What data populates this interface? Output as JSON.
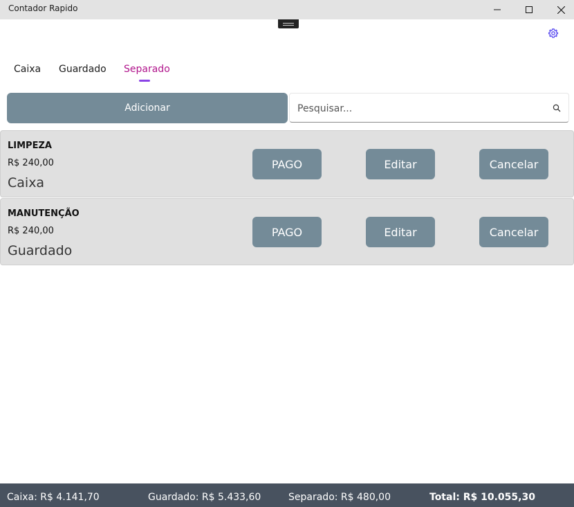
{
  "window": {
    "title": "Contador Rapido"
  },
  "tabs": [
    {
      "label": "Caixa"
    },
    {
      "label": "Guardado"
    },
    {
      "label": "Separado",
      "selected": true
    }
  ],
  "toolbar": {
    "add_label": "Adicionar",
    "search_placeholder": "Pesquisar..."
  },
  "items": [
    {
      "name": "LIMPEZA",
      "amount": "R$ 240,00",
      "location": "Caixa",
      "pay_label": "PAGO",
      "edit_label": "Editar",
      "cancel_label": "Cancelar"
    },
    {
      "name": "MANUTENÇÃO",
      "amount": "R$ 240,00",
      "location": "Guardado",
      "pay_label": "PAGO",
      "edit_label": "Editar",
      "cancel_label": "Cancelar"
    }
  ],
  "footer": {
    "caixa": "Caixa: R$ 4.141,70",
    "guardado": "Guardado: R$ 5.433,60",
    "separado": "Separado: R$ 480,00",
    "total": "Total: R$ 10.055,30"
  },
  "colors": {
    "accent_button": "#748b98",
    "active_tab": "#b0138b",
    "tab_indicator": "#8a43e6",
    "footer_bg": "#48525f",
    "card_bg": "#e0e0e0"
  },
  "icons": {
    "settings": "gear-icon",
    "search": "search-icon",
    "minimize": "minimize-icon",
    "maximize": "maximize-icon",
    "close": "close-icon"
  }
}
